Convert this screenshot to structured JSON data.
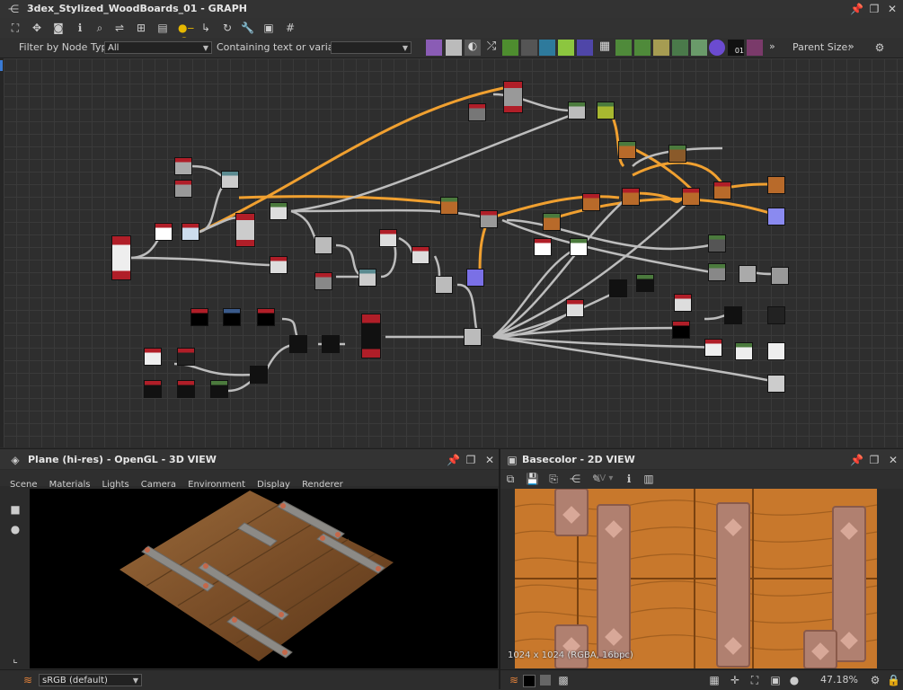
{
  "window": {
    "title": "3dex_Stylized_WoodBoards_01 - GRAPH"
  },
  "graph_toolbar": {
    "filter_label": "Filter by Node Type",
    "filter_value": "All",
    "containing_label": "Containing text or variable",
    "containing_value": "",
    "parent_size_label": "Parent Size:"
  },
  "view3d": {
    "title": "Plane (hi-res) - OpenGL - 3D VIEW",
    "menus": [
      "Scene",
      "Materials",
      "Lights",
      "Camera",
      "Environment",
      "Display",
      "Renderer"
    ],
    "colorspace": "sRGB (default)"
  },
  "view2d": {
    "title": "Basecolor - 2D VIEW",
    "uv_label": "UV",
    "image_info": "1024 x 1024 (RGBA, 16bpc)",
    "zoom": "47.18%"
  },
  "colors": {
    "accent_orange": "#f0a030",
    "wire_grey": "#b8b8b8",
    "node_red": "#b01e28",
    "node_green": "#3d6b3a",
    "node_purple": "#7a70e6"
  }
}
